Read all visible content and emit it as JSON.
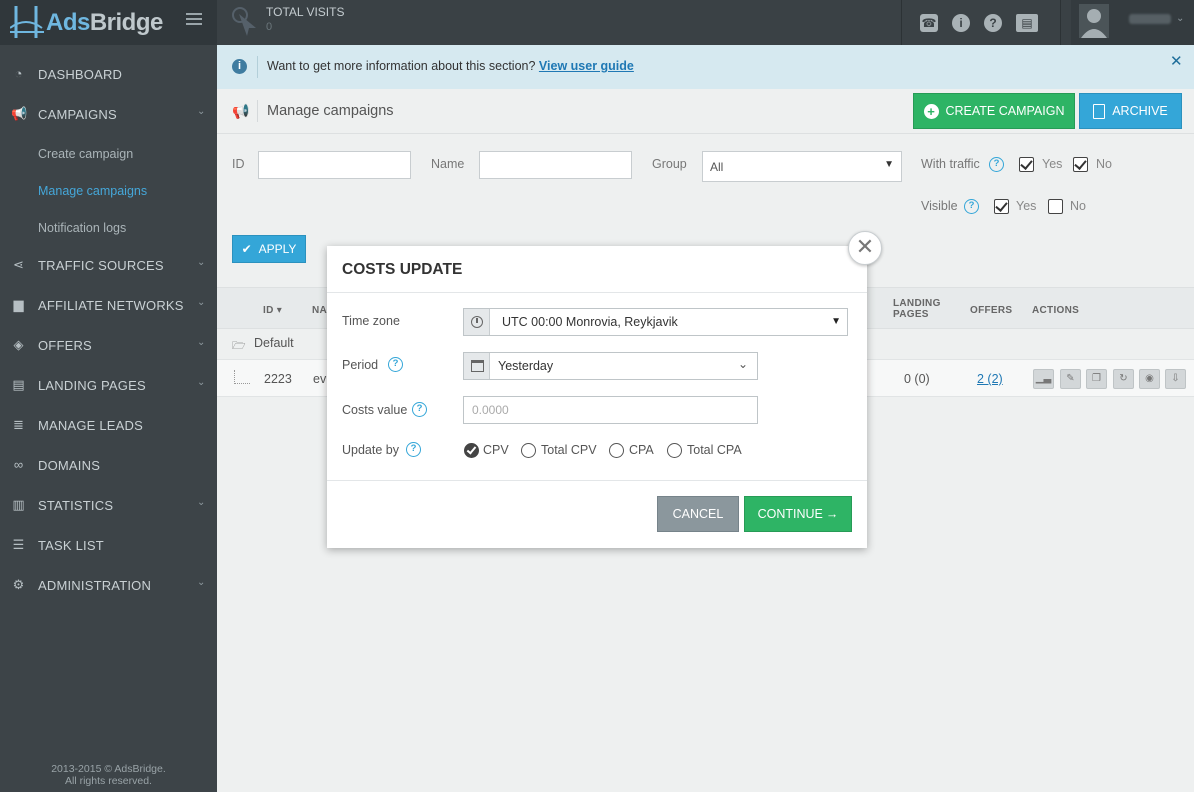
{
  "brand": {
    "name_part1": "Ads",
    "name_part2": "Bridge"
  },
  "header": {
    "total_visits_label": "TOTAL VISITS",
    "total_visits_value": "0",
    "icons": [
      "phone-icon",
      "info-icon",
      "help-icon",
      "news-icon"
    ]
  },
  "sidebar": {
    "items": [
      {
        "label": "DASHBOARD",
        "icon": "dashboard-icon"
      },
      {
        "label": "CAMPAIGNS",
        "icon": "megaphone-icon"
      },
      {
        "label": "TRAFFIC SOURCES",
        "icon": "share-icon"
      },
      {
        "label": "AFFILIATE NETWORKS",
        "icon": "briefcase-icon"
      },
      {
        "label": "OFFERS",
        "icon": "tags-icon"
      },
      {
        "label": "LANDING PAGES",
        "icon": "list-icon"
      },
      {
        "label": "MANAGE LEADS",
        "icon": "database-icon"
      },
      {
        "label": "DOMAINS",
        "icon": "link-icon"
      },
      {
        "label": "STATISTICS",
        "icon": "bar-chart-icon"
      },
      {
        "label": "TASK LIST",
        "icon": "tasks-icon"
      },
      {
        "label": "ADMINISTRATION",
        "icon": "gear-icon"
      }
    ],
    "campaign_sub": [
      "Create campaign",
      "Manage campaigns",
      "Notification logs"
    ],
    "footer_line1": "2013-2015 © AdsBridge.",
    "footer_line2": "All rights reserved."
  },
  "infobar": {
    "text": "Want to get more information about this section?",
    "link": "View user guide"
  },
  "page": {
    "title": "Manage campaigns",
    "create_button": "CREATE CAMPAIGN",
    "archive_button": "ARCHIVE"
  },
  "filters": {
    "id_label": "ID",
    "name_label": "Name",
    "group_label": "Group",
    "group_value": "All",
    "with_traffic_label": "With traffic",
    "visible_label": "Visible",
    "yes": "Yes",
    "no": "No",
    "apply": "APPLY",
    "with_traffic_yes": true,
    "with_traffic_no": true,
    "visible_yes": true,
    "visible_no": false
  },
  "table": {
    "headers": {
      "id": "ID",
      "name": "NA",
      "landing_pages_1": "LANDING",
      "landing_pages_2": "PAGES",
      "offers": "OFFERS",
      "actions": "ACTIONS"
    },
    "group": "Default",
    "rows": [
      {
        "id": "2223",
        "name": "ev",
        "landing_pages": "0 (0)",
        "offers": "2 (2)"
      }
    ]
  },
  "modal": {
    "title": "COSTS UPDATE",
    "time_zone_label": "Time zone",
    "time_zone_value": "UTC 00:00 Monrovia, Reykjavik",
    "period_label": "Period",
    "period_value": "Yesterday",
    "costs_value_label": "Costs value",
    "costs_value_placeholder": "0.0000",
    "update_by_label": "Update by",
    "update_by_options": [
      "CPV",
      "Total CPV",
      "CPA",
      "Total CPA"
    ],
    "update_by_selected": "CPV",
    "cancel": "CANCEL",
    "continue": "CONTINUE"
  },
  "colors": {
    "sidebar_bg": "#3d4448",
    "topbar_bg": "#3a4145",
    "accent_blue": "#34a6d8",
    "accent_green": "#2eb465",
    "link_active": "#45a7d9"
  }
}
